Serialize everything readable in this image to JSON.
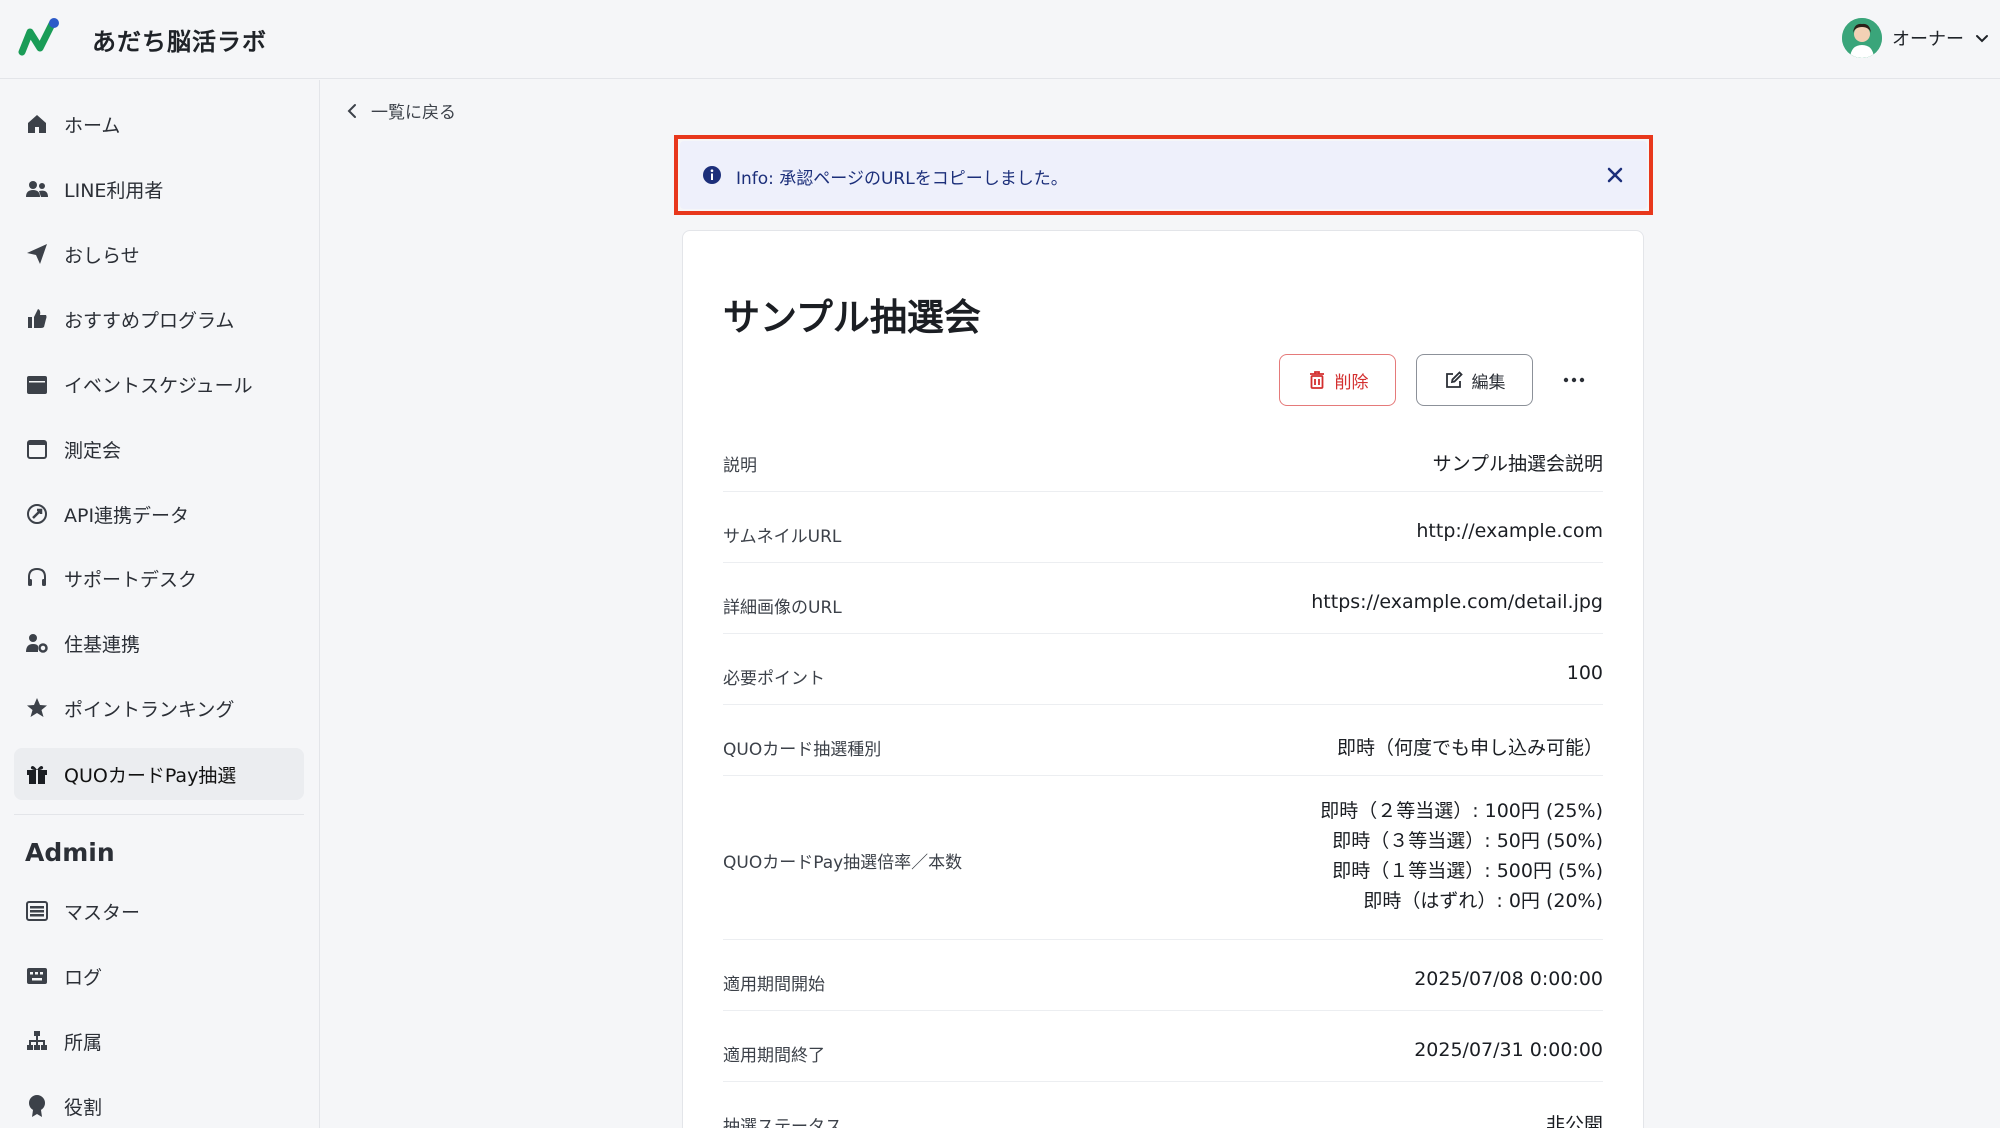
{
  "header": {
    "app_title": "あだち脳活ラボ",
    "user_name": "オーナー"
  },
  "sidebar": {
    "items": [
      {
        "label": "ホーム",
        "icon": "home-icon"
      },
      {
        "label": "LINE利用者",
        "icon": "users-icon"
      },
      {
        "label": "おしらせ",
        "icon": "paper-plane-icon"
      },
      {
        "label": "おすすめプログラム",
        "icon": "thumbs-up-icon"
      },
      {
        "label": "イベントスケジュール",
        "icon": "calendar-icon"
      },
      {
        "label": "測定会",
        "icon": "calendar-outline-icon"
      },
      {
        "label": "API連携データ",
        "icon": "api-icon"
      },
      {
        "label": "サポートデスク",
        "icon": "headset-icon"
      },
      {
        "label": "住基連携",
        "icon": "user-gear-icon"
      },
      {
        "label": "ポイントランキング",
        "icon": "star-icon"
      },
      {
        "label": "QUOカードPay抽選",
        "icon": "gift-icon",
        "active": true
      }
    ],
    "admin_heading": "Admin",
    "admin_items": [
      {
        "label": "マスター",
        "icon": "list-icon"
      },
      {
        "label": "ログ",
        "icon": "keyboard-icon"
      },
      {
        "label": "所属",
        "icon": "sitemap-icon"
      },
      {
        "label": "役割",
        "icon": "badge-icon"
      }
    ]
  },
  "main": {
    "back_label": "一覧に戻る",
    "alert_text": "Info: 承認ページのURLをコピーしました。",
    "title": "サンプル抽選会",
    "delete_label": "削除",
    "edit_label": "編集",
    "details": [
      {
        "label": "説明",
        "value": "サンプル抽選会説明"
      },
      {
        "label": "サムネイルURL",
        "value": "http://example.com"
      },
      {
        "label": "詳細画像のURL",
        "value": "https://example.com/detail.jpg"
      },
      {
        "label": "必要ポイント",
        "value": "100"
      },
      {
        "label": "QUOカード抽選種別",
        "value": "即時（何度でも申し込み可能）"
      },
      {
        "label": "QUOカードPay抽選倍率／本数",
        "values": [
          "即時（２等当選）: 100円 (25%)",
          "即時（３等当選）: 50円 (50%)",
          "即時（１等当選）: 500円 (5%)",
          "即時（はずれ）: 0円 (20%)"
        ]
      },
      {
        "label": "適用期間開始",
        "value": "2025/07/08 0:00:00"
      },
      {
        "label": "適用期間終了",
        "value": "2025/07/31 0:00:00"
      },
      {
        "label": "抽選ステータス",
        "value": "非公開"
      }
    ]
  },
  "colors": {
    "accent_red": "#e8381c",
    "alert_bg": "#eef0fb",
    "alert_text": "#1c2f7a",
    "delete_red": "#d32f2f"
  }
}
